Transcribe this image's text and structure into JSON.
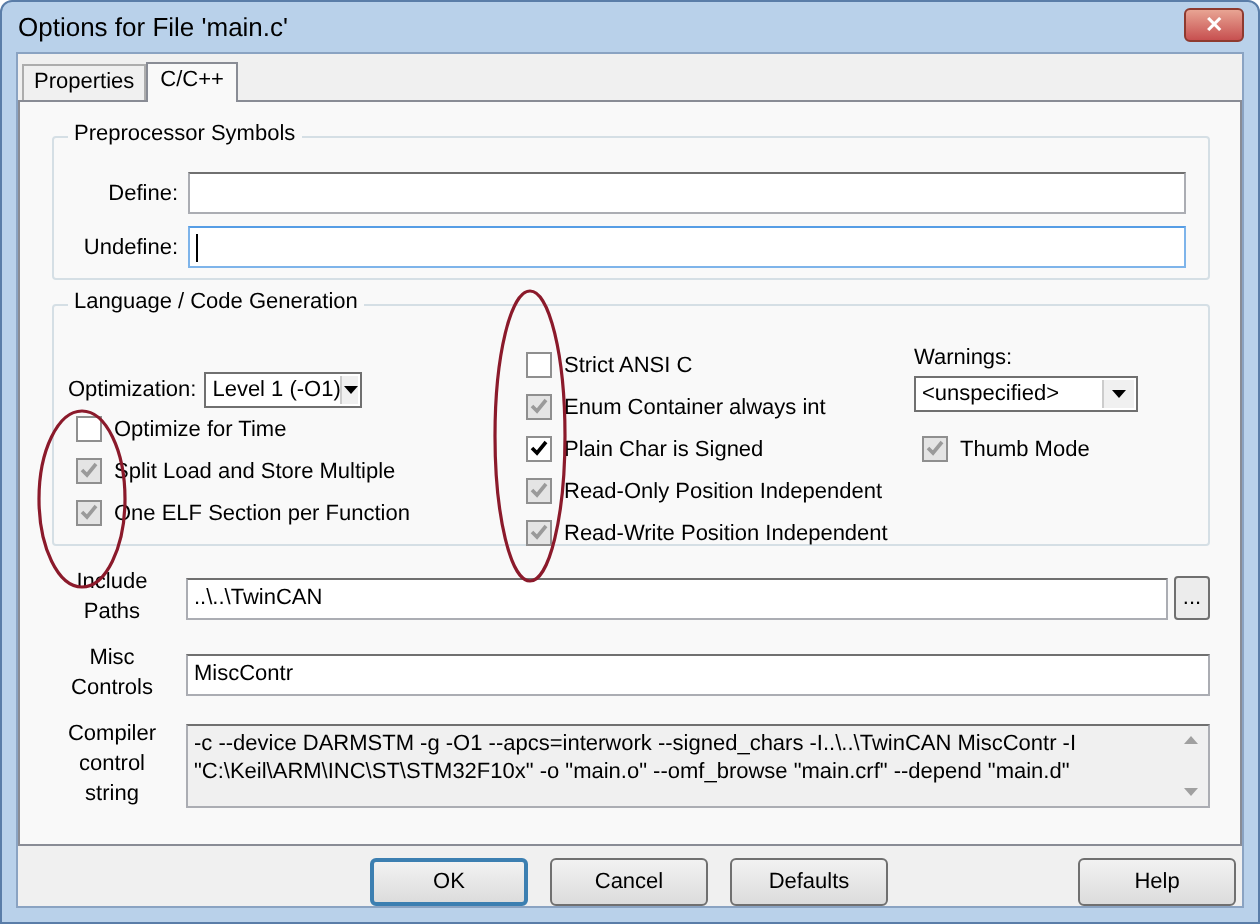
{
  "window": {
    "title": "Options for File 'main.c'",
    "close": "✕"
  },
  "tabs": [
    {
      "label": "Properties",
      "selected": false
    },
    {
      "label": "C/C++",
      "selected": true
    }
  ],
  "preprocessor": {
    "title": "Preprocessor Symbols",
    "fields": [
      {
        "label": "Define:",
        "focused": false
      },
      {
        "label": "Undefine:",
        "focused": true
      }
    ]
  },
  "language": {
    "title": "Language / Code Generation",
    "optimization": {
      "label": "Optimization:",
      "value": "Level 1 (-O1)"
    },
    "options_left": [
      {
        "label": "Optimize for Time",
        "checked": false,
        "greyed": false
      },
      {
        "label": "Split Load and Store Multiple",
        "checked": true,
        "greyed": true
      },
      {
        "label": "One ELF Section per Function",
        "checked": true,
        "greyed": true
      }
    ],
    "options_middle": [
      {
        "label": "Strict ANSI C",
        "checked": false,
        "greyed": false
      },
      {
        "label": "Enum Container always int",
        "checked": true,
        "greyed": true
      },
      {
        "label": "Plain Char is Signed",
        "checked": true,
        "greyed": false
      },
      {
        "label": "Read-Only Position Independent",
        "checked": true,
        "greyed": true
      },
      {
        "label": "Read-Write Position Independent",
        "checked": true,
        "greyed": true
      }
    ],
    "warnings": {
      "label": "Warnings:",
      "value": "<unspecified>"
    },
    "options_right": [
      {
        "label": "Thumb Mode",
        "checked": true,
        "greyed": true
      }
    ]
  },
  "include_paths": {
    "label": "Include Paths",
    "value": "..\\..\\TwinCAN",
    "browse": "..."
  },
  "misc_controls": {
    "label": "Misc Controls",
    "value": "MiscContr"
  },
  "compiler_string": {
    "label": "Compiler control string",
    "lines": [
      "-c --device DARMSTM -g -O1 --apcs=interwork --signed_chars -I..\\..\\TwinCAN MiscContr -I",
      "\"C:\\Keil\\ARM\\INC\\ST\\STM32F10x\" -o \"main.o\" --omf_browse \"main.crf\" --depend \"main.d\""
    ]
  },
  "buttons": [
    {
      "label": "OK",
      "default": true
    },
    {
      "label": "Cancel",
      "default": false
    },
    {
      "label": "Defaults",
      "default": false
    }
  ],
  "help_button": {
    "label": "Help"
  }
}
